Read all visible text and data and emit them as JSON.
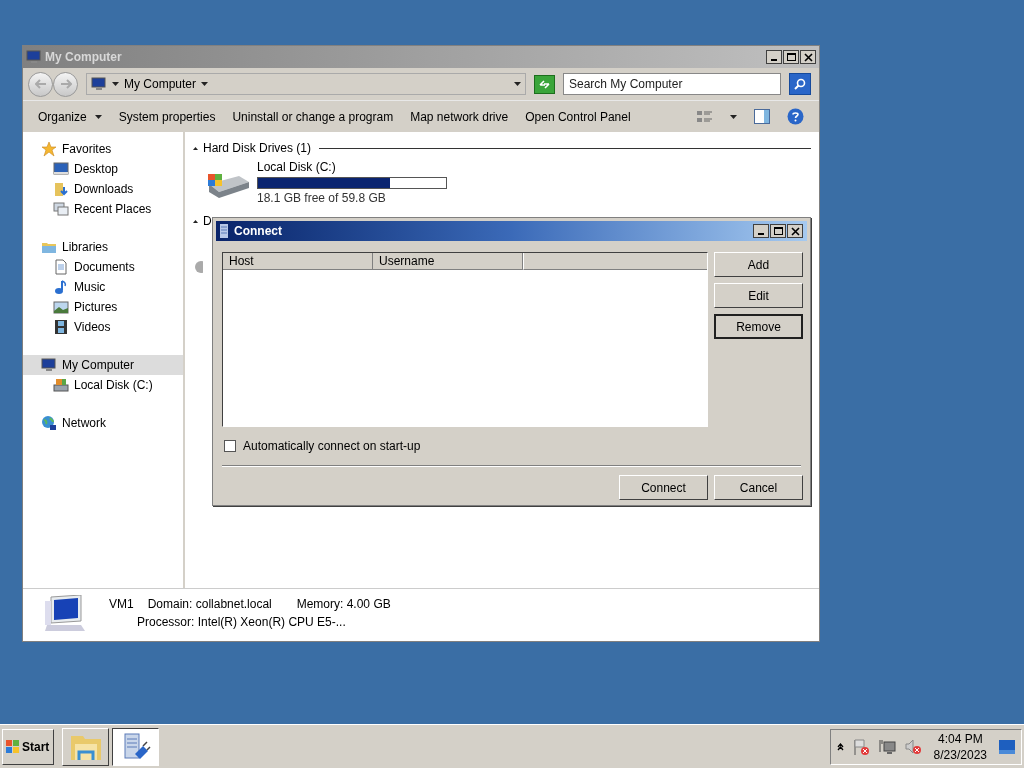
{
  "window": {
    "title": "My Computer",
    "address": "My Computer",
    "search": {
      "placeholder": "Search My Computer"
    }
  },
  "toolbar": [
    {
      "label": "Organize",
      "kind": "menu"
    },
    {
      "label": "System properties",
      "kind": "plain"
    },
    {
      "label": "Uninstall or change a program",
      "kind": "plain"
    },
    {
      "label": "Map network drive",
      "kind": "plain"
    },
    {
      "label": "Open Control Panel",
      "kind": "plain"
    }
  ],
  "sidebar": {
    "groups": [
      {
        "label": "Favorites",
        "selected": false,
        "children": [
          {
            "label": "Desktop",
            "selected": false
          },
          {
            "label": "Downloads",
            "selected": false
          },
          {
            "label": "Recent Places",
            "selected": false
          }
        ]
      },
      {
        "label": "Libraries",
        "selected": false,
        "children": [
          {
            "label": "Documents",
            "selected": false
          },
          {
            "label": "Music",
            "selected": false
          },
          {
            "label": "Pictures",
            "selected": false
          },
          {
            "label": "Videos",
            "selected": false
          }
        ]
      },
      {
        "label": "My Computer",
        "selected": true,
        "children": [
          {
            "label": "Local Disk (C:)",
            "selected": false
          }
        ]
      },
      {
        "label": "Network",
        "selected": false
      }
    ]
  },
  "content": {
    "groups": [
      {
        "heading": "Hard Disk Drives (1)",
        "drives": [
          {
            "name": "Local Disk (C:)",
            "level": 0.7,
            "free": "18.1 GB free of 59.8 GB"
          }
        ]
      },
      {
        "heading": "D"
      }
    ]
  },
  "details": {
    "name": "VM1",
    "domain": "Domain: collabnet.local",
    "memory": "Memory: 4.00 GB",
    "processor": "Processor: Intel(R) Xeon(R) CPU E5-..."
  },
  "dialog": {
    "title": "Connect",
    "columns": [
      "Host",
      "Username"
    ],
    "side_buttons": [
      {
        "label": "Add",
        "default": false
      },
      {
        "label": "Edit",
        "default": false
      },
      {
        "label": "Remove",
        "default": true
      }
    ],
    "checkbox": {
      "label": "Automatically connect on start-up",
      "checked": false
    },
    "buttons": [
      "Connect",
      "Cancel"
    ]
  },
  "taskbar": {
    "start": "Start",
    "tasks": [
      {
        "selected": false
      },
      {
        "selected": true
      }
    ],
    "time": "4:04 PM",
    "date": "8/23/2023"
  }
}
